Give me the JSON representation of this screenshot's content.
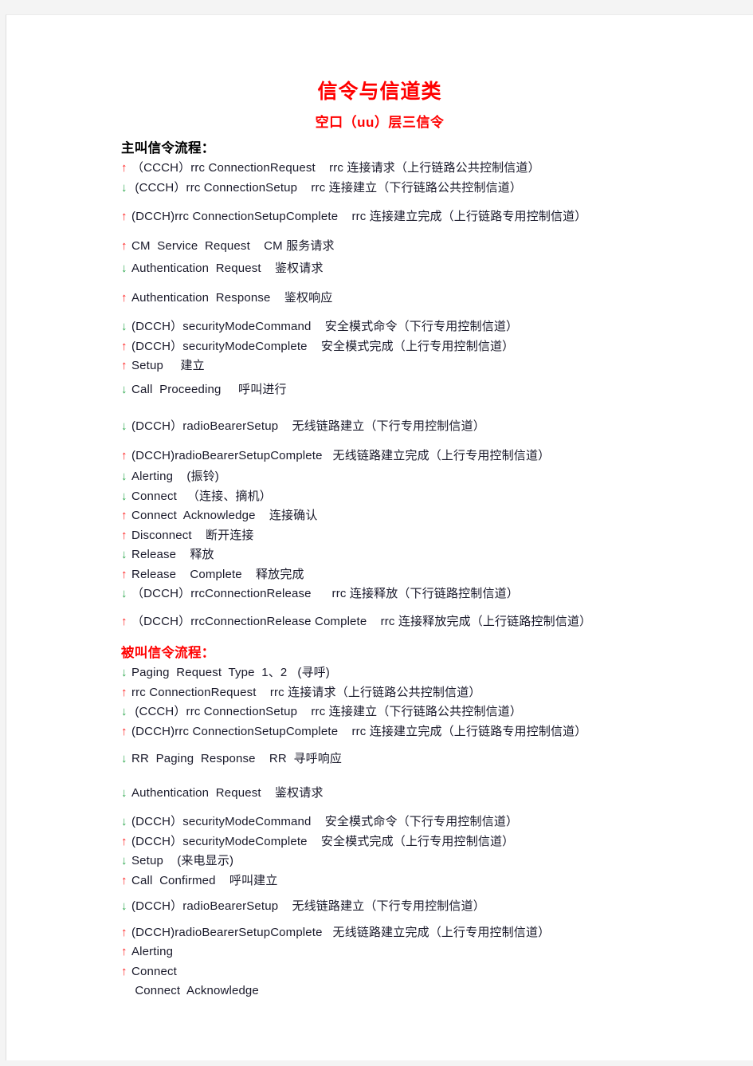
{
  "document": {
    "title": "信令与信道类",
    "subtitle": "空口（uu）层三信令"
  },
  "sections": [
    {
      "heading": "主叫信令流程：",
      "heading_color": "#000000",
      "lines": [
        {
          "arrow": "up",
          "text": "（CCCH）rrc ConnectionRequest    rrc 连接请求（上行链路公共控制信道）",
          "gap_before": 0
        },
        {
          "arrow": "down",
          "text": " (CCCH）rrc ConnectionSetup    rrc 连接建立（下行链路公共控制信道）",
          "gap_before": 0
        },
        {
          "arrow": "up",
          "text": "(DCCH)rrc ConnectionSetupComplete    rrc 连接建立完成（上行链路专用控制信道）",
          "gap_before": 12
        },
        {
          "arrow": "up",
          "text": "CM  Service  Request    CM 服务请求",
          "gap_before": 12
        },
        {
          "arrow": "down",
          "text": "Authentication  Request    鉴权请求",
          "gap_before": 4
        },
        {
          "arrow": "up",
          "text": "Authentication  Response    鉴权响应",
          "gap_before": 12
        },
        {
          "arrow": "down",
          "text": "(DCCH）securityModeCommand    安全模式命令（下行专用控制信道）",
          "gap_before": 12
        },
        {
          "arrow": "up",
          "text": "(DCCH）securityModeComplete    安全模式完成（上行专用控制信道）",
          "gap_before": 0
        },
        {
          "arrow": "up",
          "text": "Setup     建立",
          "gap_before": 0
        },
        {
          "arrow": "down",
          "text": "Call  Proceeding     呼叫进行",
          "gap_before": 5
        },
        {
          "arrow": "down",
          "text": "(DCCH）radioBearerSetup    无线链路建立（下行专用控制信道）",
          "gap_before": 22
        },
        {
          "arrow": "up",
          "text": "(DCCH)radioBearerSetupComplete   无线链路建立完成（上行专用控制信道）",
          "gap_before": 12
        },
        {
          "arrow": "down",
          "text": "Alerting    (振铃)",
          "gap_before": 2
        },
        {
          "arrow": "down",
          "text": "Connect   （连接、摘机）",
          "gap_before": 0
        },
        {
          "arrow": "up",
          "text": "Connect  Acknowledge    连接确认",
          "gap_before": 0
        },
        {
          "arrow": "up",
          "text": "Disconnect    断开连接",
          "gap_before": 0
        },
        {
          "arrow": "down",
          "text": "Release    释放",
          "gap_before": 0
        },
        {
          "arrow": "up",
          "text": "Release    Complete    释放完成",
          "gap_before": 0
        },
        {
          "arrow": "down",
          "text": "（DCCH）rrcConnectionRelease      rrc 连接释放（下行链路控制信道）",
          "gap_before": 0
        },
        {
          "arrow": "up",
          "text": "（DCCH）rrcConnectionRelease Complete    rrc 连接释放完成（上行链路控制信道）",
          "gap_before": 10
        }
      ]
    },
    {
      "heading": "被叫信令流程：",
      "heading_color": "#ff0000",
      "lines": [
        {
          "arrow": "down",
          "text": "Paging  Request  Type  1、2   (寻呼)",
          "gap_before": 0
        },
        {
          "arrow": "up",
          "text": "rrc ConnectionRequest    rrc 连接请求（上行链路公共控制信道）",
          "gap_before": 0
        },
        {
          "arrow": "down",
          "text": " (CCCH）rrc ConnectionSetup    rrc 连接建立（下行链路公共控制信道）",
          "gap_before": 0
        },
        {
          "arrow": "up",
          "text": "(DCCH)rrc ConnectionSetupComplete    rrc 连接建立完成（上行链路专用控制信道）",
          "gap_before": 0
        },
        {
          "arrow": "down",
          "text": "RR  Paging  Response    RR  寻呼响应",
          "gap_before": 10
        },
        {
          "arrow": "down",
          "text": "Authentication  Request    鉴权请求",
          "gap_before": 18
        },
        {
          "arrow": "down",
          "text": "(DCCH）securityModeCommand    安全模式命令（下行专用控制信道）",
          "gap_before": 12
        },
        {
          "arrow": "up",
          "text": "(DCCH）securityModeComplete    安全模式完成（上行专用控制信道）",
          "gap_before": 0
        },
        {
          "arrow": "down",
          "text": "Setup    (来电显示)",
          "gap_before": 0
        },
        {
          "arrow": "up",
          "text": "Call  Confirmed    呼叫建立",
          "gap_before": 0
        },
        {
          "arrow": "down",
          "text": "(DCCH）radioBearerSetup    无线链路建立（下行专用控制信道）",
          "gap_before": 8
        },
        {
          "arrow": "up",
          "text": "(DCCH)radioBearerSetupComplete   无线链路建立完成（上行专用控制信道）",
          "gap_before": 8
        },
        {
          "arrow": "up",
          "text": "Alerting",
          "gap_before": 0
        },
        {
          "arrow": "up",
          "text": "Connect",
          "gap_before": 0
        },
        {
          "arrow": "none",
          "text": " Connect  Acknowledge",
          "gap_before": 0
        }
      ]
    }
  ],
  "glyphs": {
    "up": "↑",
    "down": "↓",
    "none": " "
  }
}
